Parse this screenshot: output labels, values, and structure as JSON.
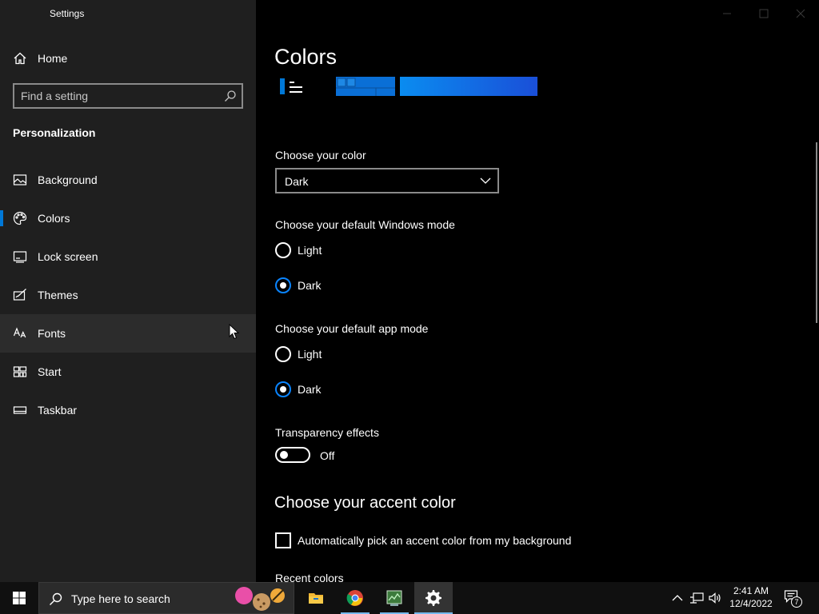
{
  "window": {
    "title": "Settings"
  },
  "sidebar": {
    "home_label": "Home",
    "search_placeholder": "Find a setting",
    "section_title": "Personalization",
    "items": [
      {
        "label": "Background",
        "icon": "picture-icon"
      },
      {
        "label": "Colors",
        "icon": "palette-icon",
        "selected": true
      },
      {
        "label": "Lock screen",
        "icon": "lock-screen-icon"
      },
      {
        "label": "Themes",
        "icon": "themes-icon"
      },
      {
        "label": "Fonts",
        "icon": "fonts-icon",
        "hovered": true
      },
      {
        "label": "Start",
        "icon": "start-icon"
      },
      {
        "label": "Taskbar",
        "icon": "taskbar-icon"
      }
    ]
  },
  "main": {
    "title": "Colors",
    "choose_color_label": "Choose your color",
    "choose_color_value": "Dark",
    "windows_mode_label": "Choose your default Windows mode",
    "windows_mode_options": [
      "Light",
      "Dark"
    ],
    "windows_mode_selected": "Dark",
    "app_mode_label": "Choose your default app mode",
    "app_mode_options": [
      "Light",
      "Dark"
    ],
    "app_mode_selected": "Dark",
    "transparency_label": "Transparency effects",
    "transparency_state": "Off",
    "accent_heading": "Choose your accent color",
    "auto_accent_label": "Automatically pick an accent color from my background",
    "recent_colors_label": "Recent colors"
  },
  "taskbar": {
    "search_text": "Type here to search",
    "apps": [
      "file-explorer-icon",
      "chrome-icon",
      "task-manager-icon",
      "settings-icon"
    ],
    "time": "2:41 AM",
    "date": "12/4/2022",
    "notification_count": "7"
  },
  "colors": {
    "accent": "#0078d7",
    "radio_selected": "#0a84ff",
    "sidebar_bg": "#1f1f1f",
    "main_bg": "#000000",
    "taskbar_bg": "#101010"
  }
}
